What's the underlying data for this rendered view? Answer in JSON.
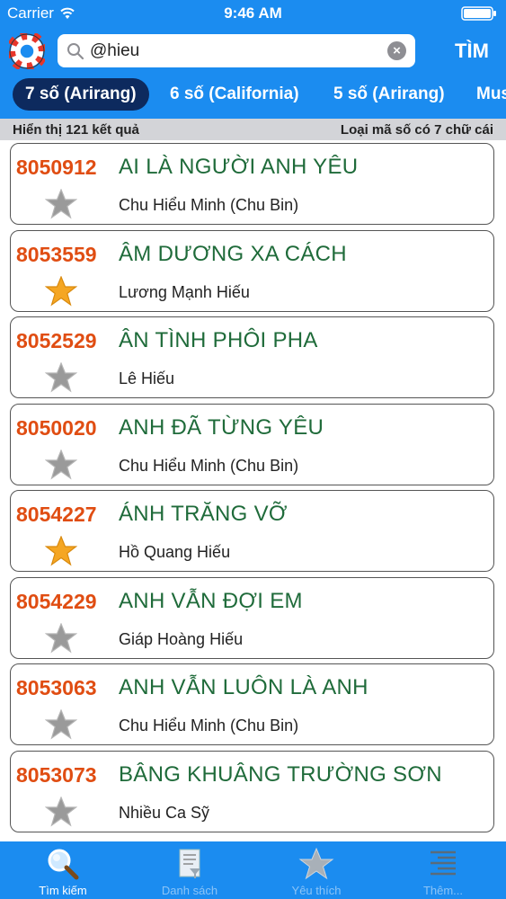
{
  "status_bar": {
    "carrier": "Carrier",
    "time": "9:46 AM"
  },
  "search": {
    "value": "@hieu",
    "button_label": "TÌM"
  },
  "tabs": [
    {
      "label": "7 số (Arirang)",
      "active": true
    },
    {
      "label": "6 số (California)",
      "active": false
    },
    {
      "label": "5 số (Arirang)",
      "active": false
    },
    {
      "label": "Mus",
      "active": false
    }
  ],
  "info_bar": {
    "result_count": "Hiển thị 121 kết quả",
    "code_type": "Loại mã số có 7 chữ cái"
  },
  "songs": [
    {
      "code": "8050912",
      "title": "AI LÀ NGƯỜI ANH YÊU",
      "artist": "Chu Hiểu Minh (Chu Bin)",
      "favorite": false
    },
    {
      "code": "8053559",
      "title": "ÂM DƯƠNG XA CÁCH",
      "artist": "Lương Mạnh Hiếu",
      "favorite": true
    },
    {
      "code": "8052529",
      "title": "ÂN TÌNH PHÔI PHA",
      "artist": "Lê Hiếu",
      "favorite": false
    },
    {
      "code": "8050020",
      "title": "ANH ĐÃ TỪNG YÊU",
      "artist": "Chu Hiểu Minh (Chu Bin)",
      "favorite": false
    },
    {
      "code": "8054227",
      "title": "ÁNH TRĂNG VỠ",
      "artist": "Hồ Quang Hiếu",
      "favorite": true
    },
    {
      "code": "8054229",
      "title": "ANH VẪN ĐỢI EM",
      "artist": "Giáp Hoàng Hiếu",
      "favorite": false
    },
    {
      "code": "8053063",
      "title": "ANH VẪN LUÔN LÀ ANH",
      "artist": "Chu Hiểu Minh (Chu Bin)",
      "favorite": false
    },
    {
      "code": "8053073",
      "title": "BÂNG KHUÂNG TRƯỜNG SƠN",
      "artist": "Nhiều Ca Sỹ",
      "favorite": false
    }
  ],
  "tab_bar": [
    {
      "label": "Tìm kiếm",
      "icon": "magnifier-icon",
      "active": true
    },
    {
      "label": "Danh sách",
      "icon": "document-list-icon",
      "active": false
    },
    {
      "label": "Yêu thích",
      "icon": "star-icon",
      "active": false
    },
    {
      "label": "Thêm...",
      "icon": "more-list-icon",
      "active": false
    }
  ],
  "colors": {
    "header_blue": "#1b8cf0",
    "active_tab": "#0d2a5e",
    "song_code": "#e04d12",
    "song_title": "#1f6b3a",
    "favorite_star": "#f5a623",
    "default_star": "#9a9a9a",
    "tab_inactive_text": "#8cc4f7"
  }
}
